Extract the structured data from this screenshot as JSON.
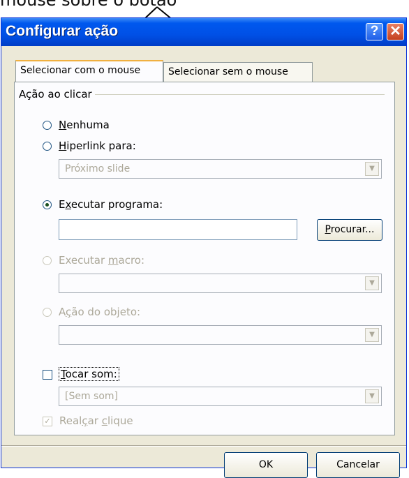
{
  "caption": "mouse sobre o botão",
  "window": {
    "title": "Configurar ação",
    "help_label": "?",
    "close_label": "✕"
  },
  "tabs": [
    {
      "label": "Selecionar com o mouse",
      "active": true
    },
    {
      "label": "Selecionar sem o mouse",
      "active": false
    }
  ],
  "group": {
    "label": "Ação ao clicar"
  },
  "options": {
    "none_pre": "",
    "none_key": "N",
    "none_post": "enhuma",
    "hyperlink_pre": "",
    "hyperlink_key": "H",
    "hyperlink_post": "iperlink para:",
    "hyperlink_value": "Próximo slide",
    "run_program_pre": "E",
    "run_program_key": "x",
    "run_program_post": "ecutar programa:",
    "run_program_value": "",
    "browse_pre": "",
    "browse_key": "P",
    "browse_post": "rocurar...",
    "run_macro_pre": "Executar ",
    "run_macro_key": "m",
    "run_macro_post": "acro:",
    "run_macro_value": "",
    "object_action_pre": "A",
    "object_action_key": "ç",
    "object_action_post": "ão do objeto:",
    "object_action_value": ""
  },
  "sound": {
    "play_pre": "",
    "play_key": "T",
    "play_post": "ocar som:",
    "checked": false,
    "value": "[Sem som]"
  },
  "highlight": {
    "pre": "Real",
    "key": "ç",
    "mid": "ar ",
    "key2": "c",
    "post": "lique",
    "checked": true,
    "check_glyph": "✓"
  },
  "footer": {
    "ok_label": "OK",
    "cancel_label": "Cancelar"
  },
  "dropdown_glyph": "▼"
}
